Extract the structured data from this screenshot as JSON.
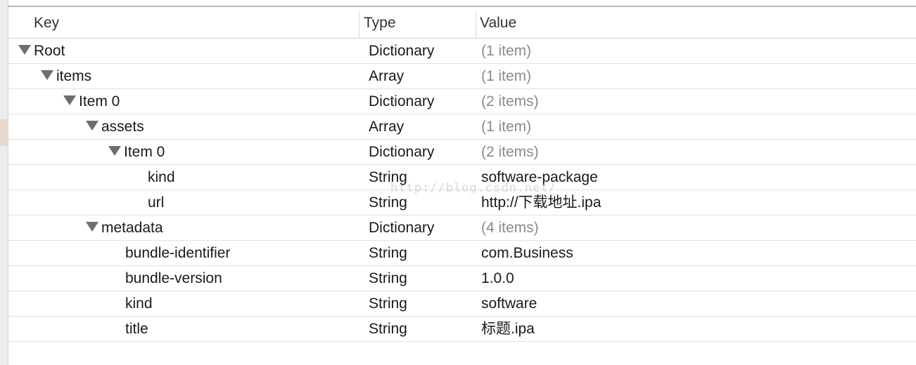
{
  "header": {
    "key_label": "Key",
    "type_label": "Type",
    "value_label": "Value"
  },
  "rows": [
    {
      "key": "Root",
      "type": "Dictionary",
      "value": "(1 item)"
    },
    {
      "key": "items",
      "type": "Array",
      "value": "(1 item)"
    },
    {
      "key": "Item 0",
      "type": "Dictionary",
      "value": "(2 items)"
    },
    {
      "key": "assets",
      "type": "Array",
      "value": "(1 item)"
    },
    {
      "key": "Item 0",
      "type": "Dictionary",
      "value": "(2 items)"
    },
    {
      "key": "kind",
      "type": "String",
      "value": "software-package"
    },
    {
      "key": "url",
      "type": "String",
      "value": "http://下载地址.ipa"
    },
    {
      "key": "metadata",
      "type": "Dictionary",
      "value": "(4 items)"
    },
    {
      "key": "bundle-identifier",
      "type": "String",
      "value": "com.Business"
    },
    {
      "key": "bundle-version",
      "type": "String",
      "value": "1.0.0"
    },
    {
      "key": "kind",
      "type": "String",
      "value": "software"
    },
    {
      "key": "title",
      "type": "String",
      "value": "标题.ipa"
    }
  ],
  "watermark": "http://blog.csdn.net/",
  "colors": {
    "muted_value": "#8a8a8a",
    "disclosure_triangle": "#6e6e6e",
    "row_separator": "#e2e2e2"
  }
}
